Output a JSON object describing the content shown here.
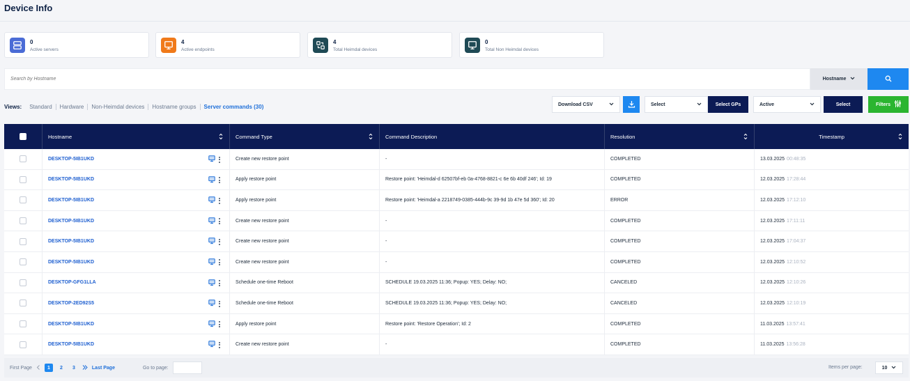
{
  "page": {
    "title": "Device Info"
  },
  "stats": [
    {
      "value": "0",
      "label": "Active servers",
      "icon": "server-icon",
      "color": "#4b6cd6"
    },
    {
      "value": "4",
      "label": "Active endpoints",
      "icon": "monitor-icon",
      "color": "#f07a1a"
    },
    {
      "value": "4",
      "label": "Total Heimdal devices",
      "icon": "heimdal-device-icon",
      "color": "#1f4a55"
    },
    {
      "value": "0",
      "label": "Total Non Heimdal devices",
      "icon": "monitor-icon",
      "color": "#1f4a55"
    }
  ],
  "search": {
    "placeholder": "Search by Hostname",
    "field_select": "Hostname"
  },
  "views": {
    "label": "Views:",
    "items": [
      "Standard",
      "Hardware",
      "Non-Heimdal devices",
      "Hostname groups",
      "Server commands (30)"
    ],
    "active": "Server commands (30)"
  },
  "toolbar": {
    "download_label": "Download CSV",
    "gp_select": "Select",
    "select_gps_label": "Select GPs",
    "status_select": "Active",
    "select_label": "Select",
    "filters_label": "Filters"
  },
  "colors": {
    "navy": "#0c1b55",
    "blue": "#1e88f0",
    "green": "#2bb530",
    "link": "#1e5fd0"
  },
  "table": {
    "columns": [
      "Hostname",
      "Command Type",
      "Command Description",
      "Resolution",
      "Timestamp"
    ],
    "rows": [
      {
        "hostname": "DESKTOP-5IB1UKD",
        "command_type": "Create new restore point",
        "description": "-",
        "resolution": "COMPLETED",
        "date": "13.03.2025",
        "time": "00:48:35"
      },
      {
        "hostname": "DESKTOP-5IB1UKD",
        "command_type": "Apply restore point",
        "description": "Restore point: 'Heimdal-d 62507bf-eb 0a-4768-8821-c 6e 6b 40df 246'; Id: 19",
        "resolution": "COMPLETED",
        "date": "12.03.2025",
        "time": "17:28:44"
      },
      {
        "hostname": "DESKTOP-5IB1UKD",
        "command_type": "Apply restore point",
        "description": "Restore point: 'Heimdal-a 2218749-0385-444b-9c 39-9d 1b 47e 5d 360'; Id: 20",
        "resolution": "ERROR",
        "date": "12.03.2025",
        "time": "17:12:10"
      },
      {
        "hostname": "DESKTOP-5IB1UKD",
        "command_type": "Create new restore point",
        "description": "-",
        "resolution": "COMPLETED",
        "date": "12.03.2025",
        "time": "17:11:11"
      },
      {
        "hostname": "DESKTOP-5IB1UKD",
        "command_type": "Create new restore point",
        "description": "-",
        "resolution": "COMPLETED",
        "date": "12.03.2025",
        "time": "17:04:37"
      },
      {
        "hostname": "DESKTOP-5IB1UKD",
        "command_type": "Create new restore point",
        "description": "-",
        "resolution": "COMPLETED",
        "date": "12.03.2025",
        "time": "12:10:52"
      },
      {
        "hostname": "DESKTOP-GFG1LLA",
        "command_type": "Schedule one-time Reboot",
        "description": "SCHEDULE 19.03.2025 11:36; Popup: YES; Delay: NO;",
        "resolution": "CANCELED",
        "date": "12.03.2025",
        "time": "12:10:26"
      },
      {
        "hostname": "DESKTOP-2ED92S5",
        "command_type": "Schedule one-time Reboot",
        "description": "SCHEDULE 19.03.2025 11:36; Popup: YES; Delay: NO;",
        "resolution": "CANCELED",
        "date": "12.03.2025",
        "time": "12:10:19"
      },
      {
        "hostname": "DESKTOP-5IB1UKD",
        "command_type": "Apply restore point",
        "description": "Restore point: 'Restore Operation'; Id: 2",
        "resolution": "COMPLETED",
        "date": "11.03.2025",
        "time": "13:57:41"
      },
      {
        "hostname": "DESKTOP-5IB1UKD",
        "command_type": "Create new restore point",
        "description": "-",
        "resolution": "COMPLETED",
        "date": "11.03.2025",
        "time": "13:56:28"
      }
    ]
  },
  "pagination": {
    "first_label": "First Page",
    "last_label": "Last Page",
    "pages": [
      "1",
      "2",
      "3"
    ],
    "current": "1",
    "goto_label": "Go to page:",
    "items_per_page_label": "Items per page:",
    "items_per_page": "10"
  }
}
